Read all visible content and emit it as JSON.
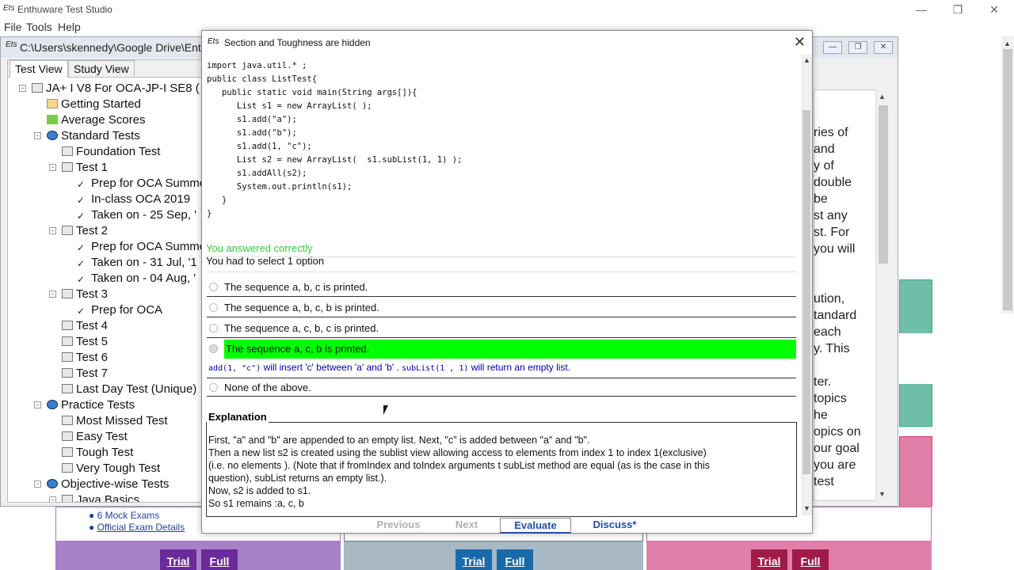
{
  "app": {
    "logo": "Ets",
    "title": "Enthuware Test Studio"
  },
  "menu": [
    "File",
    "Tools",
    "Help"
  ],
  "inner": {
    "title": "C:\\Users\\skennedy\\Google Drive\\Enth"
  },
  "tabs": [
    "Test View",
    "Study View"
  ],
  "tree": [
    {
      "label": "JA+ I V8 For OCA-JP-I SE8 (",
      "icon": "java-icon"
    },
    {
      "label": "Getting Started",
      "icon": "book-icon"
    },
    {
      "label": "Average Scores",
      "icon": "chart-icon"
    },
    {
      "label": "Standard Tests",
      "icon": "globe-icon"
    },
    {
      "label": "Foundation Test",
      "icon": "test-icon"
    },
    {
      "label": "Test 1",
      "icon": "test-icon"
    },
    {
      "label": "Prep for OCA Summe",
      "icon": "attempt-icon"
    },
    {
      "label": "In-class OCA 2019",
      "icon": "attempt-icon"
    },
    {
      "label": "Taken on - 25 Sep, '",
      "icon": "done-icon"
    },
    {
      "label": "Test 2",
      "icon": "test-icon"
    },
    {
      "label": "Prep for OCA Summe",
      "icon": "attempt-icon"
    },
    {
      "label": "Taken on - 31 Jul, '1",
      "icon": "attempt-icon"
    },
    {
      "label": "Taken on - 04 Aug, '",
      "icon": "done-icon"
    },
    {
      "label": "Test 3",
      "icon": "test-icon"
    },
    {
      "label": "Prep for OCA",
      "icon": "attempt-icon"
    },
    {
      "label": "Test 4",
      "icon": "test-icon"
    },
    {
      "label": "Test 5",
      "icon": "test-icon"
    },
    {
      "label": "Test 6",
      "icon": "test-icon"
    },
    {
      "label": "Test 7",
      "icon": "test-icon"
    },
    {
      "label": "Last Day Test (Unique)",
      "icon": "test-icon"
    },
    {
      "label": "Practice Tests",
      "icon": "globe-icon"
    },
    {
      "label": "Most Missed Test",
      "icon": "test-icon"
    },
    {
      "label": "Easy Test",
      "icon": "test-icon"
    },
    {
      "label": "Tough Test",
      "icon": "test-icon"
    },
    {
      "label": "Very Tough Test",
      "icon": "test-icon"
    },
    {
      "label": "Objective-wise Tests",
      "icon": "globe-icon"
    },
    {
      "label": "Java Basics",
      "icon": "test-icon"
    }
  ],
  "right_text": [
    "ries of",
    "and",
    "y of",
    "double",
    "be",
    "st any",
    "st. For",
    "you will",
    "",
    "",
    "ution,",
    "tandard",
    "each",
    "y. This",
    "",
    "ter.",
    "topics",
    "he",
    "opics on",
    "our goal",
    "you are",
    "test"
  ],
  "bottom": {
    "mock": "6 Mock Exams",
    "official": "Official Exam Details",
    "trial": "Trial",
    "full": "Full"
  },
  "dialog": {
    "title": "Section and Toughness are hidden",
    "code": "import java.util.* ;\npublic class ListTest{\n   public static void main(String args[]){\n      List s1 = new ArrayList( );\n      s1.add(\"a\");\n      s1.add(\"b\");\n      s1.add(1, \"c\");\n      List s2 = new ArrayList(  s1.subList(1, 1) );\n      s1.addAll(s2);\n      System.out.println(s1);\n   }\n}",
    "result": "You answered correctly",
    "instruction": "You had to select 1 option",
    "options": [
      "The sequence a, b, c is printed.",
      "The sequence a, b, c, b is printed.",
      "The sequence a, c, b, c is printed.",
      "The sequence a, c, b is printed.",
      "None of the above."
    ],
    "note": {
      "code1": "add(1, \"c\")",
      "text1": " will insert 'c' between 'a' and 'b' . ",
      "code2": "subList(1 , 1)",
      "text2": " will return an empty list."
    },
    "explanation_heading": "Explanation",
    "explanation": [
      "First, \"a\" and \"b\" are appended to an empty list. Next, \"c\" is added between \"a\" and \"b\".",
      "Then a new list s2 is created using the sublist view allowing access to elements from index 1 to index 1(exclusive)",
      "(i.e. no elements ). (Note that if fromIndex and toIndex arguments t subList method are equal (as is the case in this",
      "question), subList returns an empty list.).",
      "Now, s2 is added to s1.",
      "So s1 remains :a, c, b"
    ],
    "nav": {
      "previous": "Previous",
      "next": "Next",
      "evaluate": "Evaluate",
      "discuss": "Discuss*"
    }
  },
  "colors": {
    "correct": "#00ff00",
    "result_text": "#33cc33",
    "nav_link": "#1f4fa0"
  }
}
